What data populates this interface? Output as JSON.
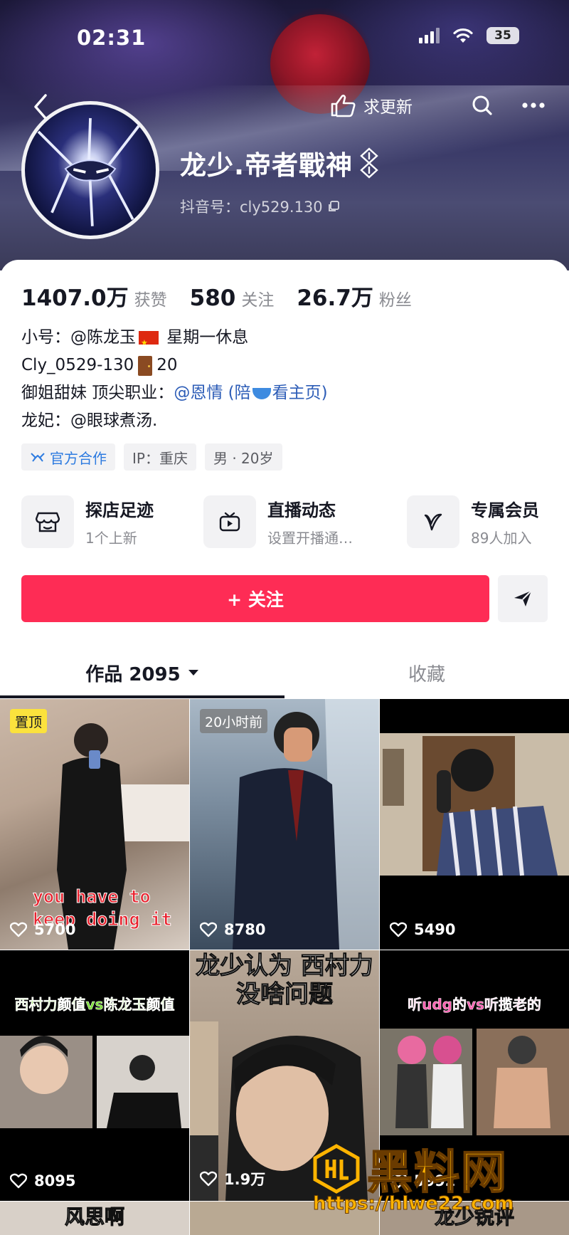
{
  "status_bar": {
    "time": "02:31",
    "battery": "35"
  },
  "header": {
    "update_label": "求更新"
  },
  "profile": {
    "name": "龙少.帝者戰神",
    "douyin_id": "抖音号：cly529.130",
    "stats": [
      {
        "value": "1407.0万",
        "label": "获赞"
      },
      {
        "value": "580",
        "label": "关注"
      },
      {
        "value": "26.7万",
        "label": "粉丝"
      }
    ],
    "bio": {
      "line1_prefix": "小号：@陈龙玉",
      "line1_suffix": " 星期一休息",
      "line2_prefix": "Cly_0529-130",
      "line2_suffix": "20",
      "line3_prefix": "御姐甜妹 顶尖职业：",
      "line3_mention_a": "@恩情 (陪",
      "line3_mention_b": "看主页)",
      "line4": "龙妃：@眼球煮汤."
    },
    "tags": [
      "官方合作",
      "IP：重庆",
      "男 · 20岁"
    ]
  },
  "features": [
    {
      "title": "探店足迹",
      "subtitle": "1个上新",
      "icon": "store-icon"
    },
    {
      "title": "直播动态",
      "subtitle": "设置开播通…",
      "icon": "tv-icon"
    },
    {
      "title": "专属会员",
      "subtitle": "89人加入",
      "icon": "v-member-icon"
    }
  ],
  "actions": {
    "follow_label": "+ 关注"
  },
  "tabs": {
    "works": "作品 2095",
    "favorites": "收藏"
  },
  "videos": [
    {
      "likes": "5700",
      "badge": "置顶",
      "overlay": [
        "you have to",
        "keep doing it"
      ]
    },
    {
      "likes": "8780",
      "badge": "20小时前"
    },
    {
      "likes": "5490"
    },
    {
      "likes": "8095",
      "caption": "西村力颜值vs陈龙玉颜值"
    },
    {
      "likes": "1.9万",
      "caption": "龙少认为 西村力 没啥问题"
    },
    {
      "likes": "5992",
      "caption": "听udg的vs听揽老的"
    },
    {
      "caption": "风思啊"
    },
    {
      "caption": ""
    },
    {
      "caption": "龙少锐评"
    }
  ],
  "watermark": {
    "brand": "黑料网",
    "url": "https://hlwe22.com"
  },
  "colors": {
    "accent": "#fe2c55",
    "mention": "#2d5db7",
    "pin_badge": "#fbe23d"
  }
}
